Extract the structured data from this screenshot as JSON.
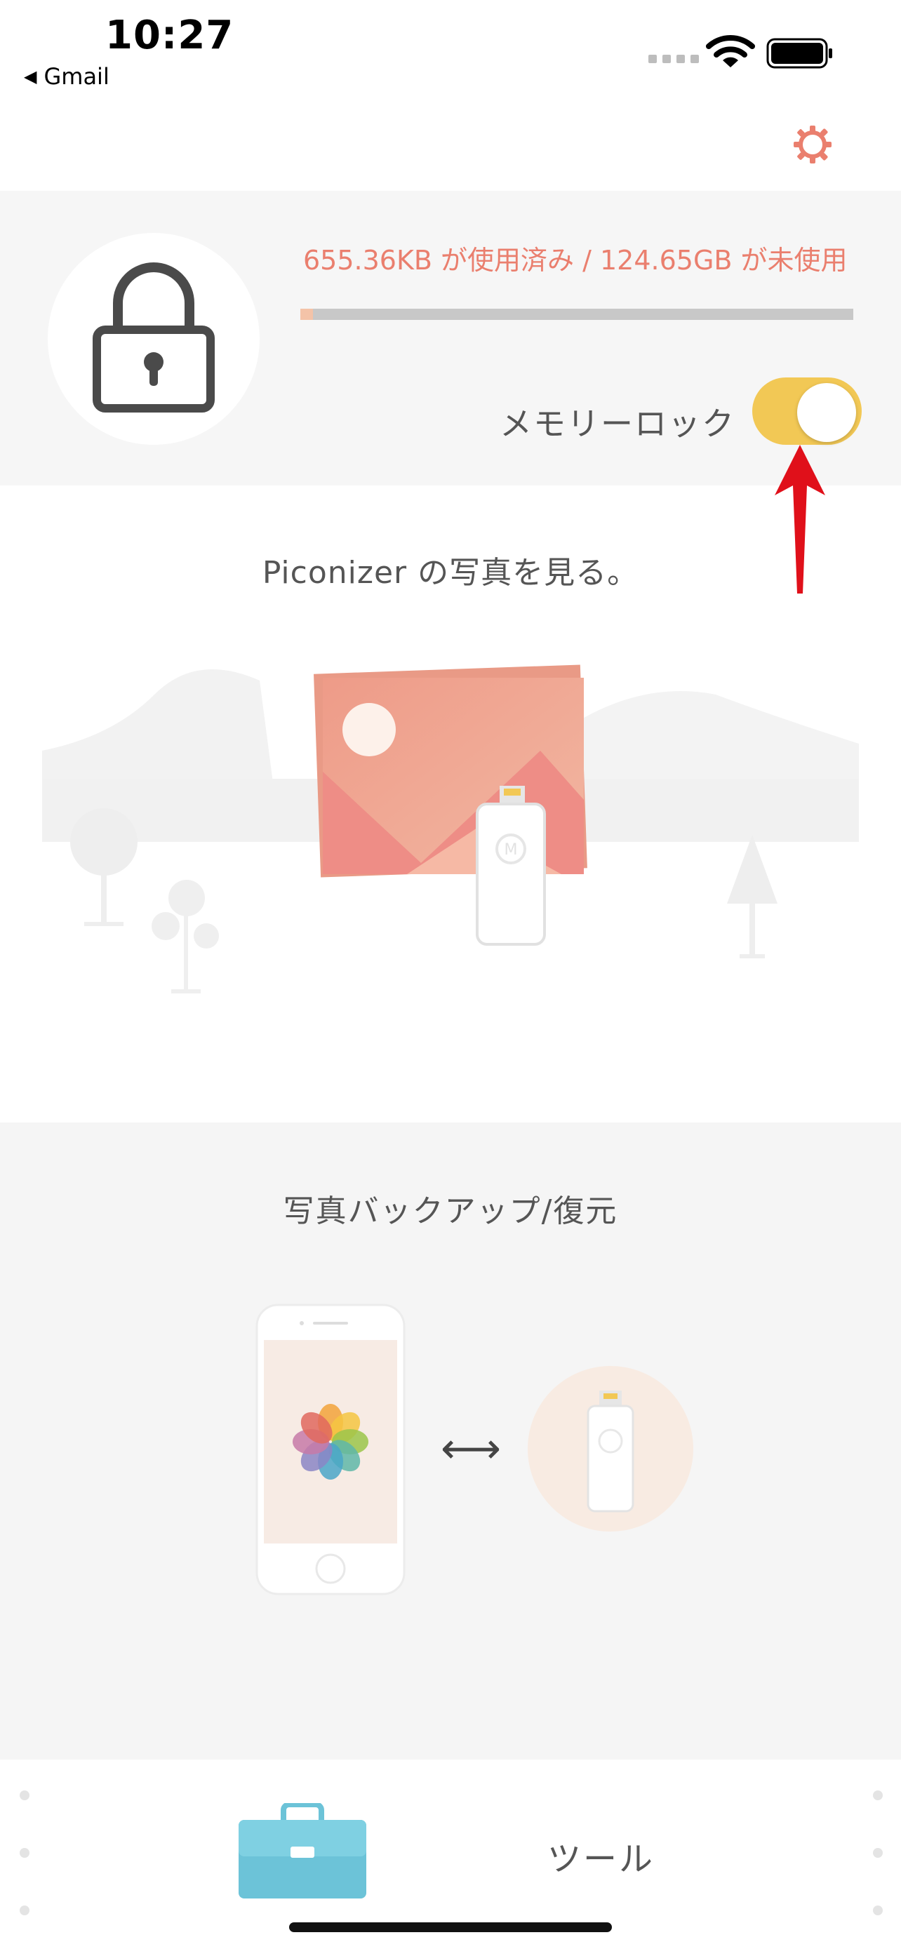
{
  "status_bar": {
    "time": "10:27",
    "back_label": "Gmail"
  },
  "storage": {
    "usage_text": "655.36KB が使用済み / 124.65GB が未使用",
    "used_fraction": 5.1e-06,
    "memory_lock_label": "メモリーロック",
    "memory_lock_on": true
  },
  "sections": {
    "view_photos_title": "Piconizer の写真を見る。",
    "backup_title": "写真バックアップ/復元",
    "swap_symbol": "⟷"
  },
  "tools": {
    "label": "ツール"
  },
  "colors": {
    "accent": "#ea7f6e",
    "toggle": "#f2c855",
    "arrow": "#e0101a",
    "toolbox": "#6cc3d8"
  },
  "icons": [
    "back-triangle-icon",
    "wifi-icon",
    "battery-icon",
    "gear-icon",
    "lock-icon",
    "arrow-up-icon",
    "photos-icon",
    "toolbox-icon"
  ]
}
